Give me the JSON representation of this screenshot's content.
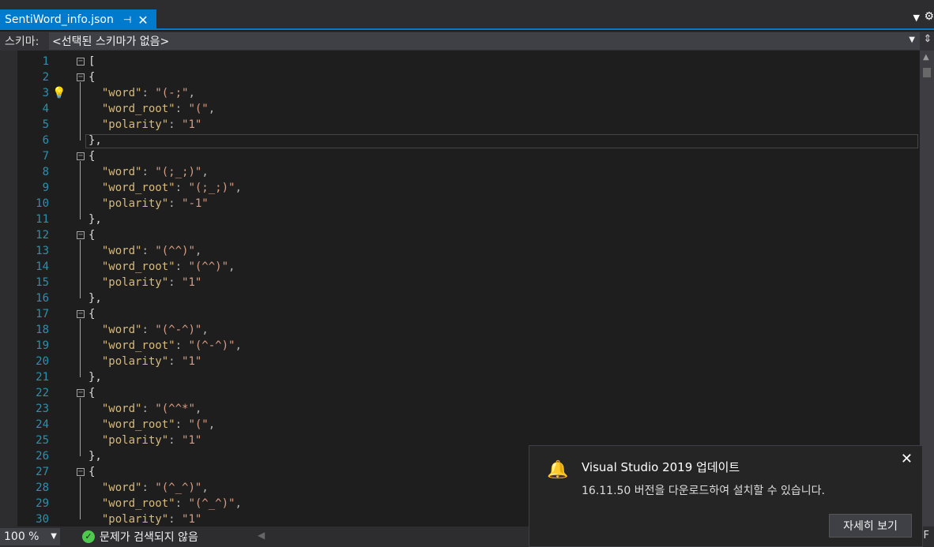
{
  "tab": {
    "title": "SentiWord_info.json",
    "pin_icon": "pin-icon",
    "close_icon": "close-icon"
  },
  "tab_bar": {
    "dropdown_icon": "chevron-down-icon",
    "settings_icon": "gear-icon"
  },
  "schema": {
    "label": "스키마:",
    "value": "<선택된 스키마가 없음>"
  },
  "editor": {
    "lines": [
      {
        "n": "1",
        "fold": "⊟",
        "text": "["
      },
      {
        "n": "2",
        "fold": "⊟",
        "text": "{"
      },
      {
        "n": "3",
        "fold": "",
        "k": "\"word\"",
        "v": "\"(-;\"",
        "end": ","
      },
      {
        "n": "4",
        "fold": "",
        "k": "\"word_root\"",
        "v": "\"(\"",
        "end": ","
      },
      {
        "n": "5",
        "fold": "",
        "k": "\"polarity\"",
        "v": "\"1\"",
        "end": ""
      },
      {
        "n": "6",
        "fold": "",
        "text": "},"
      },
      {
        "n": "7",
        "fold": "⊟",
        "text": "{"
      },
      {
        "n": "8",
        "fold": "",
        "k": "\"word\"",
        "v": "\"(;_;)\"",
        "end": ","
      },
      {
        "n": "9",
        "fold": "",
        "k": "\"word_root\"",
        "v": "\"(;_;)\"",
        "end": ","
      },
      {
        "n": "10",
        "fold": "",
        "k": "\"polarity\"",
        "v": "\"-1\"",
        "end": ""
      },
      {
        "n": "11",
        "fold": "",
        "text": "},"
      },
      {
        "n": "12",
        "fold": "⊟",
        "text": "{"
      },
      {
        "n": "13",
        "fold": "",
        "k": "\"word\"",
        "v": "\"(^^)\"",
        "end": ","
      },
      {
        "n": "14",
        "fold": "",
        "k": "\"word_root\"",
        "v": "\"(^^)\"",
        "end": ","
      },
      {
        "n": "15",
        "fold": "",
        "k": "\"polarity\"",
        "v": "\"1\"",
        "end": ""
      },
      {
        "n": "16",
        "fold": "",
        "text": "},"
      },
      {
        "n": "17",
        "fold": "⊟",
        "text": "{"
      },
      {
        "n": "18",
        "fold": "",
        "k": "\"word\"",
        "v": "\"(^-^)\"",
        "end": ","
      },
      {
        "n": "19",
        "fold": "",
        "k": "\"word_root\"",
        "v": "\"(^-^)\"",
        "end": ","
      },
      {
        "n": "20",
        "fold": "",
        "k": "\"polarity\"",
        "v": "\"1\"",
        "end": ""
      },
      {
        "n": "21",
        "fold": "",
        "text": "},"
      },
      {
        "n": "22",
        "fold": "⊟",
        "text": "{"
      },
      {
        "n": "23",
        "fold": "",
        "k": "\"word\"",
        "v": "\"(^^*\"",
        "end": ","
      },
      {
        "n": "24",
        "fold": "",
        "k": "\"word_root\"",
        "v": "\"(\"",
        "end": ","
      },
      {
        "n": "25",
        "fold": "",
        "k": "\"polarity\"",
        "v": "\"1\"",
        "end": ""
      },
      {
        "n": "26",
        "fold": "",
        "text": "},"
      },
      {
        "n": "27",
        "fold": "⊟",
        "text": "{"
      },
      {
        "n": "28",
        "fold": "",
        "k": "\"word\"",
        "v": "\"(^_^)\"",
        "end": ","
      },
      {
        "n": "29",
        "fold": "",
        "k": "\"word_root\"",
        "v": "\"(^_^)\"",
        "end": ","
      },
      {
        "n": "30",
        "fold": "",
        "k": "\"polarity\"",
        "v": "\"1\"",
        "end": ""
      }
    ],
    "lightbulb_line": "3",
    "colors": {
      "key": "#d7ba7d",
      "string": "#d69d85",
      "line_number": "#2b91af"
    }
  },
  "status": {
    "zoom": "100 %",
    "issues": "문제가 검색되지 않음",
    "right_char": "F"
  },
  "toast": {
    "title": "Visual Studio 2019 업데이트",
    "message": "16.11.50 버전을 다운로드하여 설치할 수 있습니다.",
    "button": "자세히 보기",
    "icon": "bell-icon"
  }
}
